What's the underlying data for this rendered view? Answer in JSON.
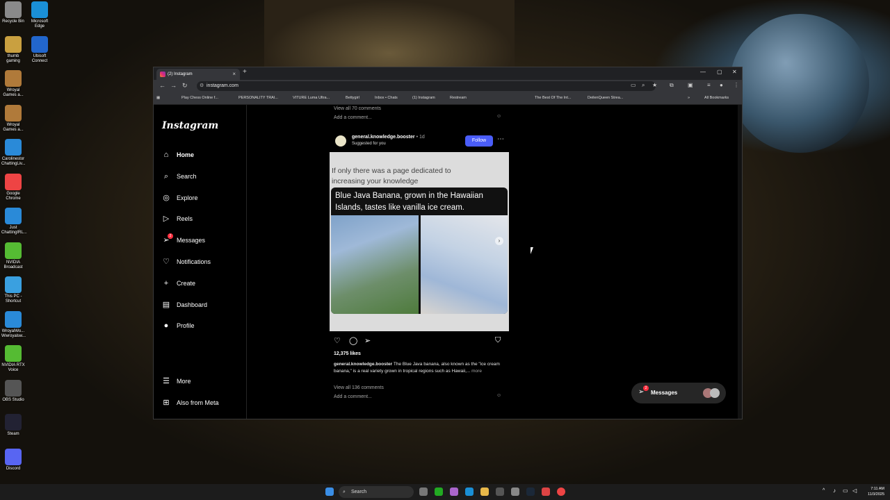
{
  "desktop": {
    "icons_col1": [
      "Recycle Bin",
      "thumb gaming",
      "Wroyal Games a...",
      "Wroyal Games a...",
      "Carolinestor ChattingLiv...",
      "Google Chrome",
      "Just ChattingIRL...",
      "NVIDIA Broadcast",
      "This PC - Shortcut",
      "WroyalWo... Wwroyalsw...",
      "NVIDIA RTX Voice",
      "OBS Studio",
      "Steam",
      "Discord"
    ],
    "icons_col2": [
      "Microsoft Edge",
      "Ubisoft Connect"
    ]
  },
  "browser": {
    "tab_title": "(2) Instagram",
    "url": "instagram.com",
    "bookmarks": [
      "Play Chess Online f...",
      "PERSONALITY TRAI...",
      "VITURE Luma Ultra...",
      "Bettygirl",
      "Inbox • Chats",
      "(1) Instagram",
      "Restream",
      "The Best Of The Int...",
      "DeilenQueen Strea..."
    ],
    "all_bookmarks": "All Bookmarks"
  },
  "instagram": {
    "logo": "Instagram",
    "nav": [
      {
        "label": "Home",
        "icon": "home-icon"
      },
      {
        "label": "Search",
        "icon": "search-icon"
      },
      {
        "label": "Explore",
        "icon": "compass-icon"
      },
      {
        "label": "Reels",
        "icon": "reels-icon"
      },
      {
        "label": "Messages",
        "icon": "messenger-icon",
        "badge": "2"
      },
      {
        "label": "Notifications",
        "icon": "heart-icon"
      },
      {
        "label": "Create",
        "icon": "plus-icon"
      },
      {
        "label": "Dashboard",
        "icon": "chart-icon"
      },
      {
        "label": "Profile",
        "icon": "avatar-icon"
      }
    ],
    "more": "More",
    "meta": "Also from Meta",
    "prev_post": {
      "view_comments": "View all 70 comments",
      "add_comment": "Add a comment..."
    },
    "post": {
      "username": "general.knowledge.booster",
      "time": "• 1d",
      "suggested": "Suggested for you",
      "follow": "Follow",
      "image_caption": "If only there was a page dedicated to increasing your knowledge",
      "image_headline": "Blue Java Banana, grown in the Hawaiian Islands, tastes like vanilla ice cream.",
      "likes": "12,375 likes",
      "caption_user": "general.knowledge.booster",
      "caption_text": "The Blue Java banana, also known as the \"ice cream banana,\" is a real variety grown in tropical regions such as Hawaii,...",
      "more": "more",
      "view_comments": "View all 136 comments",
      "add_comment": "Add a comment..."
    },
    "messages_bar": {
      "label": "Messages",
      "badge": "2"
    }
  },
  "taskbar": {
    "search": "Search",
    "time": "7:11 AM",
    "date": "11/3/2025"
  }
}
